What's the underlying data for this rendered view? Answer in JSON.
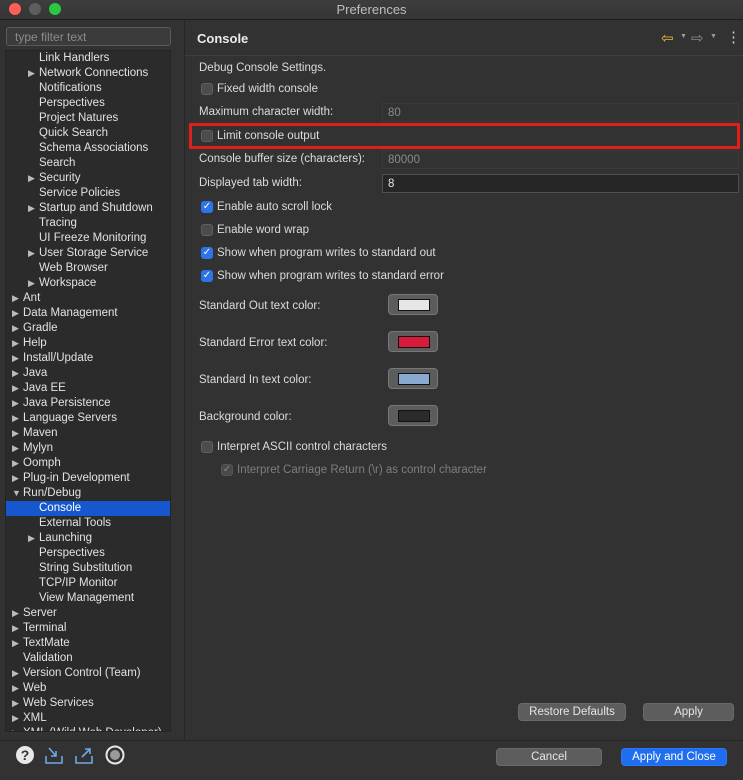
{
  "window": {
    "title": "Preferences"
  },
  "filter": {
    "placeholder": "type filter text"
  },
  "tree": [
    {
      "label": "Link Handlers",
      "level": 2,
      "expandable": false,
      "selected": false
    },
    {
      "label": "Network Connections",
      "level": 2,
      "expandable": true,
      "selected": false
    },
    {
      "label": "Notifications",
      "level": 2,
      "expandable": false,
      "selected": false
    },
    {
      "label": "Perspectives",
      "level": 2,
      "expandable": false,
      "selected": false
    },
    {
      "label": "Project Natures",
      "level": 2,
      "expandable": false,
      "selected": false
    },
    {
      "label": "Quick Search",
      "level": 2,
      "expandable": false,
      "selected": false
    },
    {
      "label": "Schema Associations",
      "level": 2,
      "expandable": false,
      "selected": false
    },
    {
      "label": "Search",
      "level": 2,
      "expandable": false,
      "selected": false
    },
    {
      "label": "Security",
      "level": 2,
      "expandable": true,
      "selected": false
    },
    {
      "label": "Service Policies",
      "level": 2,
      "expandable": false,
      "selected": false
    },
    {
      "label": "Startup and Shutdown",
      "level": 2,
      "expandable": true,
      "selected": false
    },
    {
      "label": "Tracing",
      "level": 2,
      "expandable": false,
      "selected": false
    },
    {
      "label": "UI Freeze Monitoring",
      "level": 2,
      "expandable": false,
      "selected": false
    },
    {
      "label": "User Storage Service",
      "level": 2,
      "expandable": true,
      "selected": false
    },
    {
      "label": "Web Browser",
      "level": 2,
      "expandable": false,
      "selected": false
    },
    {
      "label": "Workspace",
      "level": 2,
      "expandable": true,
      "selected": false
    },
    {
      "label": "Ant",
      "level": 1,
      "expandable": true,
      "selected": false
    },
    {
      "label": "Data Management",
      "level": 1,
      "expandable": true,
      "selected": false
    },
    {
      "label": "Gradle",
      "level": 1,
      "expandable": true,
      "selected": false
    },
    {
      "label": "Help",
      "level": 1,
      "expandable": true,
      "selected": false
    },
    {
      "label": "Install/Update",
      "level": 1,
      "expandable": true,
      "selected": false
    },
    {
      "label": "Java",
      "level": 1,
      "expandable": true,
      "selected": false
    },
    {
      "label": "Java EE",
      "level": 1,
      "expandable": true,
      "selected": false
    },
    {
      "label": "Java Persistence",
      "level": 1,
      "expandable": true,
      "selected": false
    },
    {
      "label": "Language Servers",
      "level": 1,
      "expandable": true,
      "selected": false
    },
    {
      "label": "Maven",
      "level": 1,
      "expandable": true,
      "selected": false
    },
    {
      "label": "Mylyn",
      "level": 1,
      "expandable": true,
      "selected": false
    },
    {
      "label": "Oomph",
      "level": 1,
      "expandable": true,
      "selected": false
    },
    {
      "label": "Plug-in Development",
      "level": 1,
      "expandable": true,
      "selected": false
    },
    {
      "label": "Run/Debug",
      "level": 1,
      "expandable": true,
      "expanded": true,
      "selected": false
    },
    {
      "label": "Console",
      "level": 2,
      "expandable": false,
      "selected": true
    },
    {
      "label": "External Tools",
      "level": 2,
      "expandable": false,
      "selected": false
    },
    {
      "label": "Launching",
      "level": 2,
      "expandable": true,
      "selected": false
    },
    {
      "label": "Perspectives",
      "level": 2,
      "expandable": false,
      "selected": false
    },
    {
      "label": "String Substitution",
      "level": 2,
      "expandable": false,
      "selected": false
    },
    {
      "label": "TCP/IP Monitor",
      "level": 2,
      "expandable": false,
      "selected": false
    },
    {
      "label": "View Management",
      "level": 2,
      "expandable": false,
      "selected": false
    },
    {
      "label": "Server",
      "level": 1,
      "expandable": true,
      "selected": false
    },
    {
      "label": "Terminal",
      "level": 1,
      "expandable": true,
      "selected": false
    },
    {
      "label": "TextMate",
      "level": 1,
      "expandable": true,
      "selected": false
    },
    {
      "label": "Validation",
      "level": 1,
      "expandable": false,
      "selected": false
    },
    {
      "label": "Version Control (Team)",
      "level": 1,
      "expandable": true,
      "selected": false
    },
    {
      "label": "Web",
      "level": 1,
      "expandable": true,
      "selected": false
    },
    {
      "label": "Web Services",
      "level": 1,
      "expandable": true,
      "selected": false
    },
    {
      "label": "XML",
      "level": 1,
      "expandable": true,
      "selected": false
    },
    {
      "label": "XML (Wild Web Developer)",
      "level": 1,
      "expandable": true,
      "selected": false
    }
  ],
  "page": {
    "title": "Console",
    "description": "Debug Console Settings.",
    "fixed_width_label": "Fixed width console",
    "fixed_width_checked": false,
    "max_char_width_label": "Maximum character width:",
    "max_char_width_value": "80",
    "limit_output_label": "Limit console output",
    "limit_output_checked": false,
    "buffer_size_label": "Console buffer size (characters):",
    "buffer_size_value": "80000",
    "tab_width_label": "Displayed tab width:",
    "tab_width_value": "8",
    "auto_scroll_label": "Enable auto scroll lock",
    "auto_scroll_checked": true,
    "word_wrap_label": "Enable word wrap",
    "word_wrap_checked": false,
    "show_stdout_label": "Show when program writes to standard out",
    "show_stdout_checked": true,
    "show_stderr_label": "Show when program writes to standard error",
    "show_stderr_checked": true,
    "std_out_color_label": "Standard Out text color:",
    "std_out_color": "#e6e6e6",
    "std_err_color_label": "Standard Error text color:",
    "std_err_color": "#d81b3c",
    "std_in_color_label": "Standard In text color:",
    "std_in_color": "#8aa9cf",
    "background_color_label": "Background color:",
    "background_color": "#2b2b2b",
    "ascii_label": "Interpret ASCII control characters",
    "ascii_checked": false,
    "carriage_return_label": "Interpret Carriage Return (\\r) as control character",
    "carriage_return_checked": true
  },
  "buttons": {
    "restore_defaults": "Restore Defaults",
    "apply": "Apply",
    "cancel": "Cancel",
    "apply_close": "Apply and Close"
  },
  "icons": {
    "back": "back-arrow-icon",
    "forward": "forward-arrow-icon",
    "menu": "view-menu-icon",
    "help": "help-icon",
    "import": "import-icon",
    "export": "export-icon",
    "oomph": "record-icon"
  },
  "colors": {
    "highlight": "#e01e1e",
    "selection": "#1757ce",
    "primary_button": "#1f6ef0"
  }
}
